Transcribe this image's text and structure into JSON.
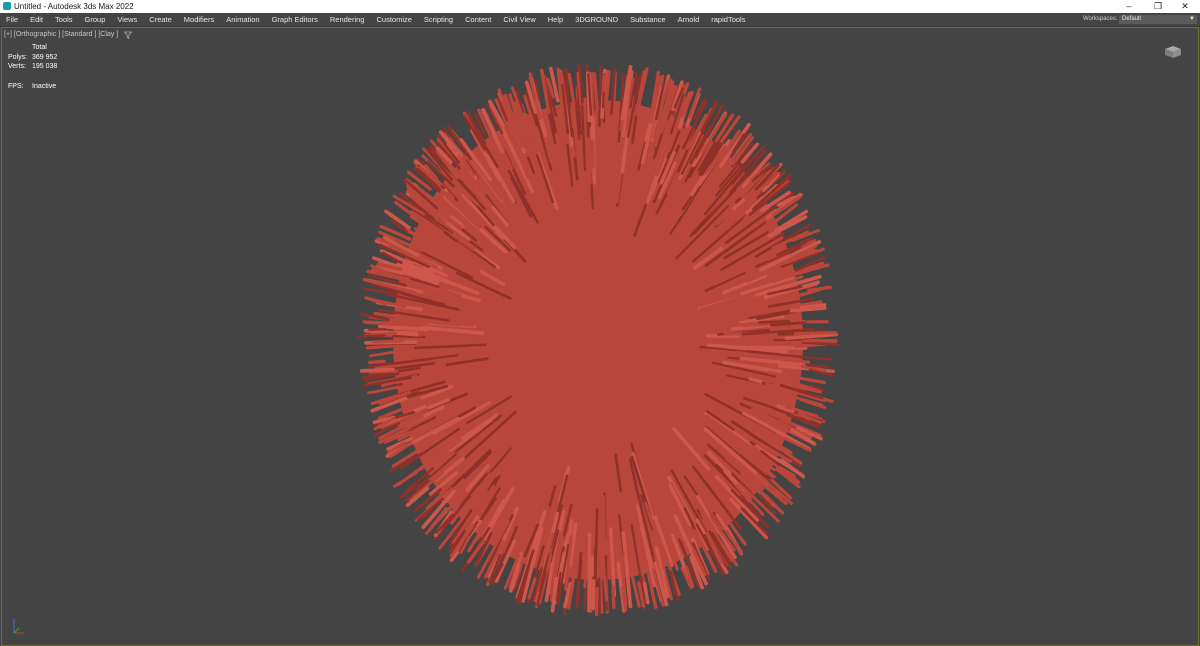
{
  "window": {
    "title": "Untitled - Autodesk 3ds Max 2022",
    "app_icon": "3dsmax-icon",
    "controls": [
      "minimize-icon",
      "restore-icon",
      "close-icon"
    ]
  },
  "menu": {
    "items": [
      "File",
      "Edit",
      "Tools",
      "Group",
      "Views",
      "Create",
      "Modifiers",
      "Animation",
      "Graph Editors",
      "Rendering",
      "Customize",
      "Scripting",
      "Content",
      "Civil View",
      "Help",
      "3DGROUND",
      "Substance",
      "Arnold",
      "rapidTools"
    ],
    "workspaces_label": "Workspaces:",
    "workspaces_value": "Default"
  },
  "viewport": {
    "label": "[+] [Orthographic ] [Standard ] [Clay ]",
    "stats": {
      "header": "Total",
      "polys_label": "Polys:",
      "polys_value": "369 952",
      "verts_label": "Verts:",
      "verts_value": "195 038",
      "fps_label": "FPS:",
      "fps_value": "Inactive"
    }
  },
  "colors": {
    "viewport_bg": "#444444",
    "object": "#b8463b",
    "object_dark": "#8f3128",
    "object_light": "#cc574a",
    "active_border": "#6e6d36"
  }
}
